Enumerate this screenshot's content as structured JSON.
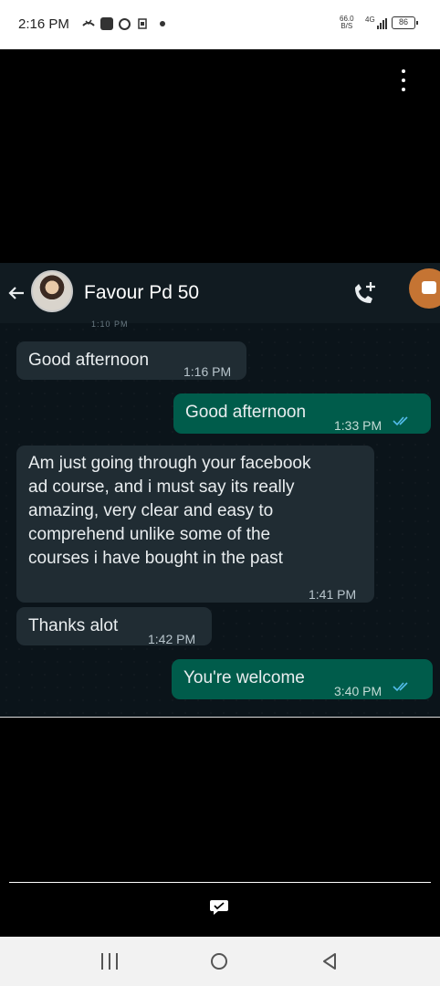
{
  "status_bar": {
    "time": "2:16 PM",
    "net_speed": "66.0",
    "net_unit": "B/S",
    "network_type": "4G",
    "battery": "86",
    "icons": [
      "missed-call-icon",
      "app-icon",
      "facebook-icon",
      "volte-icon",
      "dot-icon",
      "signal-icon",
      "battery-icon"
    ]
  },
  "viewer": {
    "menu_icon": "more-vertical-icon"
  },
  "chat": {
    "contact_name": "Favour Pd 50",
    "cut_off_label": "1:10 PM",
    "icons": [
      "back-arrow-icon",
      "avatar",
      "add-call-icon"
    ],
    "messages": [
      {
        "direction": "in",
        "text": "Good afternoon",
        "time": "1:16 PM"
      },
      {
        "direction": "out",
        "text": "Good afternoon",
        "time": "1:33 PM",
        "status": "read"
      },
      {
        "direction": "in",
        "lines": [
          "Am just going through your facebook",
          "ad course, and i must say its really",
          "amazing, very clear and easy to",
          "comprehend unlike some of the",
          "courses i have bought in the past"
        ],
        "time": "1:41 PM"
      },
      {
        "direction": "in",
        "text": "Thanks alot",
        "time": "1:42 PM"
      },
      {
        "direction": "out",
        "text": "You're welcome",
        "time": "3:40 PM",
        "status": "read"
      }
    ],
    "colors": {
      "incoming": "#202c33",
      "outgoing": "#005c4b",
      "background": "#0b141a",
      "read_ticks": "#53bdeb"
    }
  },
  "caption": {
    "comment_icon": "comment-icon"
  },
  "nav_bar": {
    "icons": [
      "recents-icon",
      "home-icon",
      "back-icon"
    ]
  }
}
